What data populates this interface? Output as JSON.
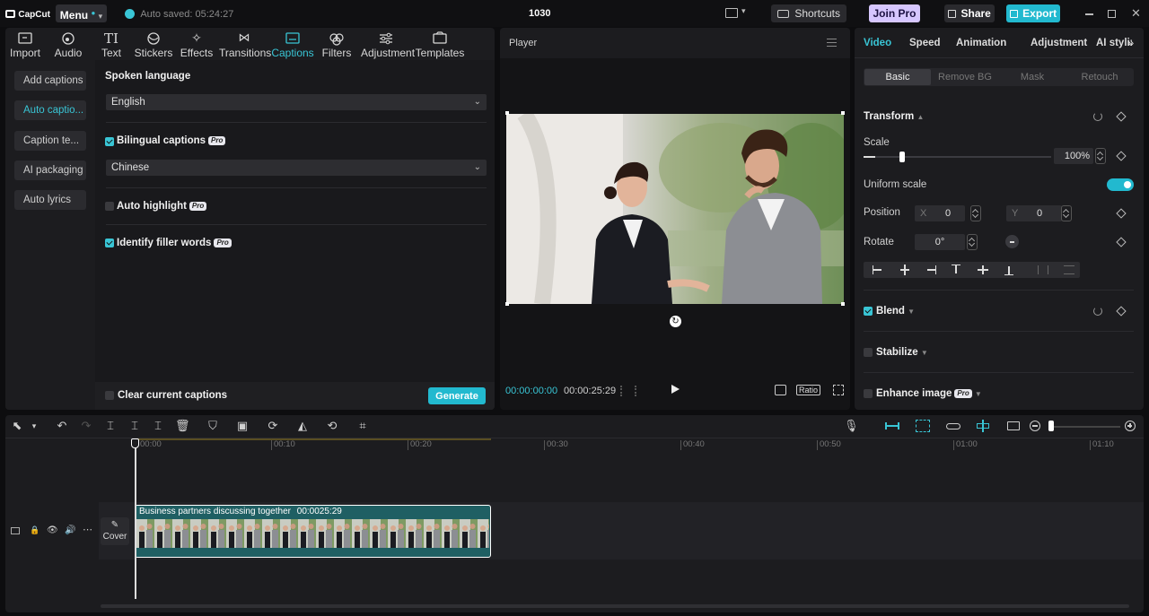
{
  "app": {
    "logo_text": "CapCut",
    "menu_label": "Menu",
    "autosave_text": "Auto saved: 05:24:27",
    "project_title": "1030",
    "shortcuts_label": "Shortcuts",
    "joinpro_label": "Join Pro",
    "share_label": "Share",
    "export_label": "Export"
  },
  "toolbar": {
    "items": [
      {
        "label": "Import",
        "icon": "import-icon"
      },
      {
        "label": "Audio",
        "icon": "audio-icon"
      },
      {
        "label": "Text",
        "icon": "text-icon"
      },
      {
        "label": "Stickers",
        "icon": "stickers-icon"
      },
      {
        "label": "Effects",
        "icon": "effects-icon"
      },
      {
        "label": "Transitions",
        "icon": "transitions-icon"
      },
      {
        "label": "Captions",
        "icon": "captions-icon",
        "active": true
      },
      {
        "label": "Filters",
        "icon": "filters-icon"
      },
      {
        "label": "Adjustment",
        "icon": "adjustment-icon"
      },
      {
        "label": "Templates",
        "icon": "templates-icon"
      }
    ]
  },
  "captions": {
    "side": [
      "Add captions",
      "Auto captio...",
      "Caption te...",
      "AI packaging",
      "Auto lyrics"
    ],
    "spoken_language_label": "Spoken language",
    "spoken_language_value": "English",
    "bilingual_label": "Bilingual captions",
    "bilingual_language_value": "Chinese",
    "auto_highlight_label": "Auto highlight",
    "filler_label": "Identify filler words",
    "pro_badge": "Pro",
    "clear_label": "Clear current captions",
    "generate_label": "Generate"
  },
  "player": {
    "title": "Player",
    "current_time": "00:00:00:00",
    "total_time": "00:00:25:29",
    "ratio_label": "Ratio"
  },
  "inspector": {
    "tabs": [
      "Video",
      "Speed",
      "Animation",
      "Adjustment",
      "AI stylize"
    ],
    "subtabs": [
      "Basic",
      "Remove BG",
      "Mask",
      "Retouch"
    ],
    "transform_label": "Transform",
    "scale_label": "Scale",
    "scale_value": "100%",
    "scale_fraction": 0.06,
    "uniform_scale_label": "Uniform scale",
    "position_label": "Position",
    "pos_x_label": "X",
    "pos_x_value": "0",
    "pos_y_label": "Y",
    "pos_y_value": "0",
    "rotate_label": "Rotate",
    "rotate_value": "0°",
    "blend_label": "Blend",
    "stabilize_label": "Stabilize",
    "enhance_label": "Enhance image",
    "pro_badge": "Pro"
  },
  "timeline": {
    "ticks": [
      "00:00",
      "00:10",
      "00:20",
      "00:30",
      "00:40",
      "00:50",
      "01:00",
      "01:10"
    ],
    "clip_title": "Business partners discussing together",
    "clip_duration": "00:0025:29",
    "cover_label": "Cover"
  },
  "colors": {
    "accent": "#39c5d5",
    "joinpro": "#d6c6ff",
    "clip": "#1f5f63"
  }
}
